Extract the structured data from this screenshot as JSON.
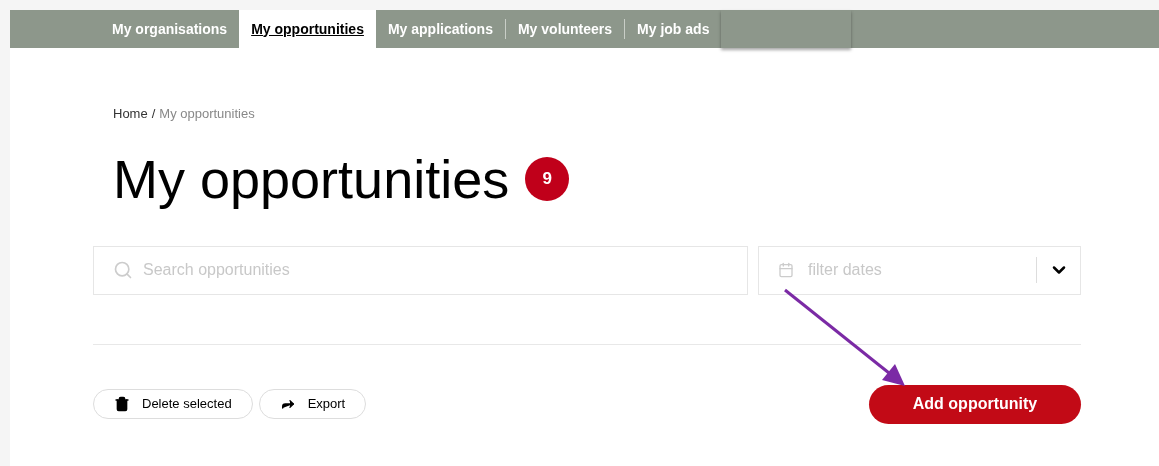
{
  "nav": {
    "tabs": [
      {
        "label": "My organisations",
        "selected": false
      },
      {
        "label": "My opportunities",
        "selected": true
      },
      {
        "label": "My applications",
        "selected": false
      },
      {
        "label": "My volunteers",
        "selected": false
      },
      {
        "label": "My job ads",
        "selected": false
      }
    ]
  },
  "breadcrumb": [
    {
      "label": "Home",
      "current": false
    },
    {
      "label": "My opportunities",
      "current": true
    }
  ],
  "breadcrumb_separator": "/",
  "title": "My opportunities",
  "count": "9",
  "search": {
    "placeholder": "Search opportunities"
  },
  "date_filter": {
    "placeholder": "filter dates"
  },
  "actions": [
    {
      "label": "Delete selected",
      "kind": "delete"
    },
    {
      "label": "Export",
      "kind": "export"
    }
  ],
  "primary_action": {
    "label": "Add opportunity"
  }
}
